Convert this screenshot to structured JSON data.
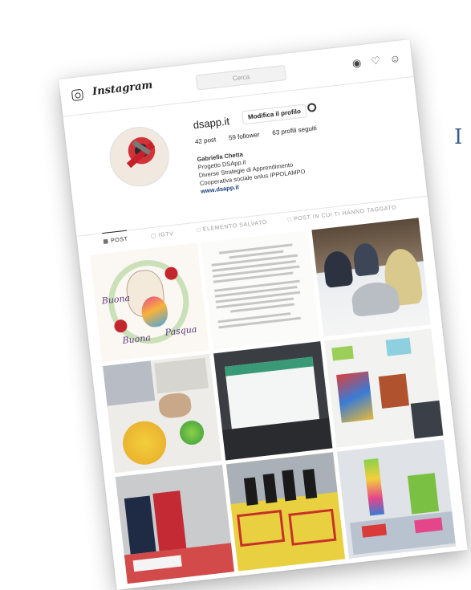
{
  "edge": {
    "letter": "I"
  },
  "topbar": {
    "brand": "Instagram",
    "search_placeholder": "Cerca",
    "icons": [
      "instagram-icon",
      "compass-icon",
      "heart-icon",
      "profile-icon"
    ]
  },
  "profile": {
    "username": "dsapp.it",
    "edit_label": "Modifica il profilo",
    "stats": {
      "posts": "42 post",
      "followers": "59 follower",
      "following": "63 profili seguiti"
    },
    "bio": {
      "name": "Gabriella Chetta",
      "line1": "Progetto DSApp.it",
      "line2": "Diverse Strategie di Apprendimento",
      "line3": "Cooperativa sociale onlus IPPOLAMPO",
      "link": "www.dsapp.it"
    }
  },
  "tabs": [
    {
      "label": "POST",
      "active": true
    },
    {
      "label": "IGTV",
      "active": false
    },
    {
      "label": "ELEMENTO SALVATO",
      "active": false
    },
    {
      "label": "POST IN CUI TI HANNO TAGGATO",
      "active": false
    }
  ],
  "posts": {
    "p1": {
      "text_top": "Buona",
      "text_bottom": "Pasqua",
      "text_left": "Buona"
    }
  },
  "colors": {
    "link": "#1d3f7a",
    "accent": "#3a5c8a"
  }
}
